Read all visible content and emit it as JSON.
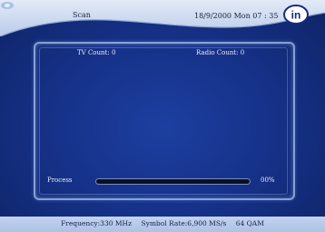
{
  "header": {
    "title": "Scan",
    "datetime": "18/9/2000 Mon 07 : 35",
    "logo_text": "in"
  },
  "panel": {
    "tv_count_label": "TV Count:",
    "tv_count": "0",
    "radio_count_label": "Radio Count:",
    "radio_count": "0"
  },
  "progress": {
    "label": "Process",
    "percent_text": "00%",
    "fraction": 0
  },
  "status_bar": {
    "frequency": "Frequency:330 MHz",
    "symbol_rate": "Symbol Rate:6,900 MS/s",
    "modulation": "64 QAM"
  },
  "colors": {
    "background": "#16328a",
    "header": "#c9d7ee",
    "text": "#eaeefa"
  },
  "icons": {
    "scan": "scan-icon",
    "logo": "logo-icon"
  }
}
